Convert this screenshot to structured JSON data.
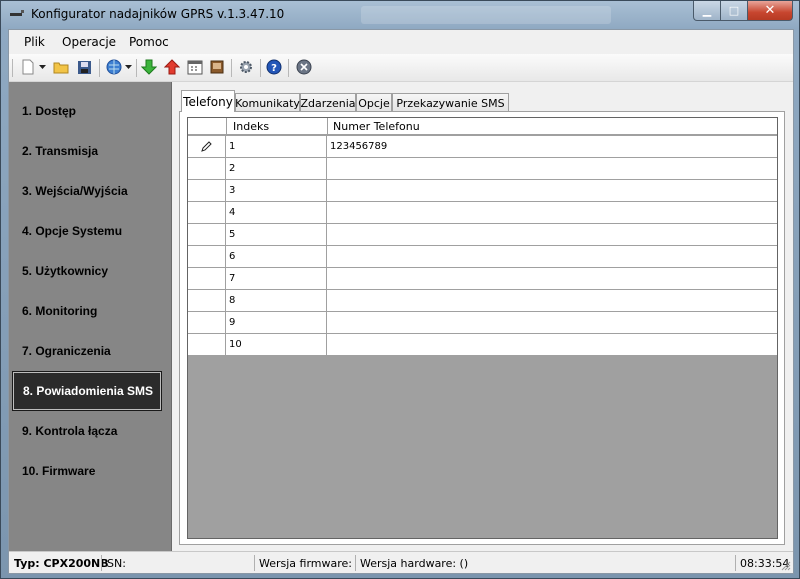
{
  "window": {
    "title": "Konfigurator nadajników GPRS v.1.3.47.10"
  },
  "menu": {
    "items": [
      "Plik",
      "Operacje",
      "Pomoc"
    ]
  },
  "toolbar": {
    "icons": [
      "new-icon",
      "dropdown-arrow-icon",
      "open-folder-icon",
      "save-icon",
      "globe-icon",
      "dropdown-arrow-icon",
      "download-arrow-icon",
      "upload-arrow-icon",
      "calendar-icon",
      "book-icon",
      "settings-icon",
      "help-icon",
      "disconnect-icon"
    ]
  },
  "sidebar": {
    "items": [
      {
        "label": "1. Dostęp"
      },
      {
        "label": "2. Transmisja"
      },
      {
        "label": "3. Wejścia/Wyjścia"
      },
      {
        "label": "4. Opcje Systemu"
      },
      {
        "label": "5. Użytkownicy"
      },
      {
        "label": "6. Monitoring"
      },
      {
        "label": "7. Ograniczenia"
      },
      {
        "label": "8. Powiadomienia SMS"
      },
      {
        "label": "9. Kontrola łącza"
      },
      {
        "label": "10. Firmware"
      }
    ],
    "active_index": 7
  },
  "tabs": {
    "items": [
      "Telefony",
      "Komunikaty",
      "Zdarzenia",
      "Opcje",
      "Przekazywanie SMS"
    ],
    "active": "Telefony"
  },
  "grid": {
    "columns": [
      "Indeks",
      "Numer Telefonu"
    ],
    "rows": [
      {
        "index": "1",
        "number": "123456789"
      },
      {
        "index": "2",
        "number": ""
      },
      {
        "index": "3",
        "number": ""
      },
      {
        "index": "4",
        "number": ""
      },
      {
        "index": "5",
        "number": ""
      },
      {
        "index": "6",
        "number": ""
      },
      {
        "index": "7",
        "number": ""
      },
      {
        "index": "8",
        "number": ""
      },
      {
        "index": "9",
        "number": ""
      },
      {
        "index": "10",
        "number": ""
      }
    ],
    "editing_row": 0
  },
  "status": {
    "type": "Typ: CPX200NB",
    "sn": "SN:",
    "firmware": "Wersja firmware:",
    "hardware": "Wersja hardware: ()",
    "time": "08:33:54"
  }
}
